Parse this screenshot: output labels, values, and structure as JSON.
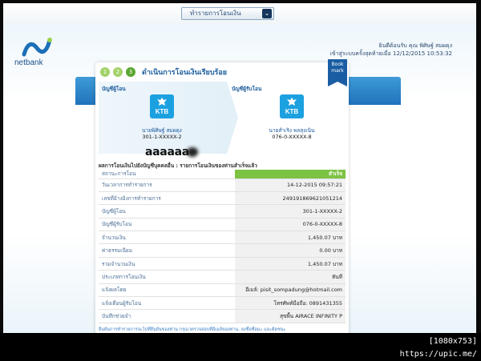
{
  "menu": {
    "label": "ทำรายการโอนเงิน"
  },
  "logo": {
    "text": "netbank"
  },
  "user": {
    "welcome": "ยินดีต้อนรับ คุณ พิศิษฐ์ สมผดุง",
    "last_login": "เข้าสู่ระบบครั้งสุดท้ายเมื่อ 12/12/2015 10:53:32"
  },
  "steps": {
    "s1": "1",
    "s2": "2",
    "s3": "3",
    "title": "ดำเนินการโอนเงินเรียบร้อย"
  },
  "bookmark": {
    "line1": "Book",
    "line2": "mark"
  },
  "from": {
    "label": "บัญชีผู้โอน",
    "bank": "KTB",
    "name": "นายพิศิษฐ์ สมผดุง",
    "number": "301-1-XXXXX-2",
    "masked": "aaaaaa"
  },
  "to": {
    "label": "บัญชีผู้รับโอน",
    "bank": "KTB",
    "name": "นายสำเริง พลสุงเนิน",
    "number": "076-0-XXXXX-8"
  },
  "result_title": "ผลการโอนเงินไปยังบัญชีบุคคลอื่น : รายการโอนเงินของท่านสำเร็จแล้ว",
  "details": [
    {
      "k": "สถานะการโอน",
      "v": "สำเร็จ"
    },
    {
      "k": "วันเวลาการทำรายการ",
      "v": "14-12-2015 09:57:21"
    },
    {
      "k": "เลขที่อ้างอิงการทำรายการ",
      "v": "249191869621051214"
    },
    {
      "k": "บัญชีผู้โอน",
      "v": "301-1-XXXXX-2"
    },
    {
      "k": "บัญชีผู้รับโอน",
      "v": "076-0-XXXXX-8"
    },
    {
      "k": "จำนวนเงิน",
      "v": "1,450.07 บาท"
    },
    {
      "k": "ค่าธรรมเนียม",
      "v": "0.00 บาท"
    },
    {
      "k": "รวมจำนวนเงิน",
      "v": "1,450.07 บาท"
    },
    {
      "k": "ประเภทการโอนเงิน",
      "v": "ทันที"
    },
    {
      "k": "แจ้งผลโดย",
      "v": "อีเมล์: pisit_sompadung@hotmail.com"
    },
    {
      "k": "แจ้งเตือนผู้รับโอน",
      "v": "โทรศัพท์มือถือ: 0891431355"
    },
    {
      "k": "บันทึกช่วยจำ",
      "v": "สุขพื้น AIRACE INFINITY P"
    }
  ],
  "footer_note": "ยืนยันการทำรายการจะไปที่ยืนยันของท่าน กรุณาตรวจสอบที่อีเมล์ของท่าน, ลงชื่อชื่อมะ และติดชนะ",
  "watermark": "[1080x753] https://upic.me/"
}
